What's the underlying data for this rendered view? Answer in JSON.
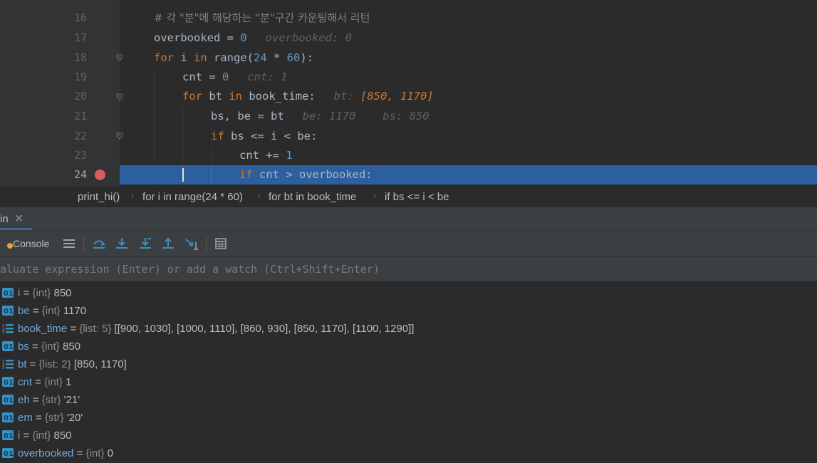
{
  "editor": {
    "lines": [
      {
        "num": "16",
        "text": "# 각 \"분\"에 해당하는 \"분\"구간 카운팅해서 리턴"
      },
      {
        "num": "17",
        "code": "overbooked = ",
        "num_lit": "0",
        "hint": "overbooked: 0"
      },
      {
        "num": "18",
        "kw": "for",
        "code": " i ",
        "kw2": "in",
        "code2": " range(",
        "n1": "24",
        "op": " * ",
        "n2": "60",
        "end": "):"
      },
      {
        "num": "19",
        "code": "cnt = ",
        "num_lit": "0",
        "hint": "cnt: 1"
      },
      {
        "num": "20",
        "kw": "for",
        "code": " bt ",
        "kw2": "in",
        "code2": " book_time:",
        "hint_label": "bt:",
        "hint_value": "[850, 1170]"
      },
      {
        "num": "21",
        "code": "bs, be = bt",
        "hint": "be: 1170",
        "hint2": "bs: 850"
      },
      {
        "num": "22",
        "kw": "if",
        "code": " bs <= i < be:"
      },
      {
        "num": "23",
        "code": "cnt += ",
        "num_lit": "1"
      },
      {
        "num": "24",
        "kw": "if",
        "code": " cnt > overbooked:"
      }
    ]
  },
  "breadcrumb": [
    "print_hi()",
    "for i in range(24 * 60)",
    "for bt in book_time",
    "if bs <= i < be"
  ],
  "debug_panel": {
    "tab_title": "in",
    "console_label": "Console",
    "evaluate_placeholder": "aluate expression (Enter) or add a watch (Ctrl+Shift+Enter)"
  },
  "variables": [
    {
      "name": "i",
      "type": "{int}",
      "value": "850",
      "kind": "int"
    },
    {
      "name": "be",
      "type": "{int}",
      "value": "1170",
      "kind": "int"
    },
    {
      "name": "book_time",
      "type": "{list: 5}",
      "value": "[[900, 1030], [1000, 1110], [860, 930], [850, 1170], [1100, 1290]]",
      "kind": "list"
    },
    {
      "name": "bs",
      "type": "{int}",
      "value": "850",
      "kind": "int"
    },
    {
      "name": "bt",
      "type": "{list: 2}",
      "value": "[850, 1170]",
      "kind": "list"
    },
    {
      "name": "cnt",
      "type": "{int}",
      "value": "1",
      "kind": "int"
    },
    {
      "name": "eh",
      "type": "{str}",
      "value": "'21'",
      "kind": "str"
    },
    {
      "name": "em",
      "type": "{str}",
      "value": "'20'",
      "kind": "str"
    },
    {
      "name": "i",
      "type": "{int}",
      "value": "850",
      "kind": "int"
    },
    {
      "name": "overbooked",
      "type": "{int}",
      "value": "0",
      "kind": "int"
    }
  ],
  "colors": {
    "highlight": "#2d5f9e",
    "keyword": "#cc7832",
    "number": "#6897bb",
    "breakpoint": "#db5c5c",
    "var_name": "#6fa8dc"
  }
}
